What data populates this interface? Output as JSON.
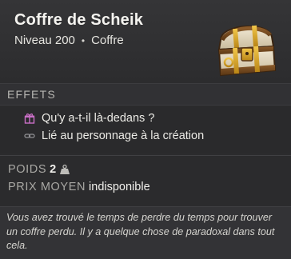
{
  "item": {
    "name": "Coffre de Scheik",
    "level_text": "Niveau 200",
    "separator": "•",
    "category": "Coffre",
    "icon": "treasure-chest-icon"
  },
  "effects": {
    "heading": "EFFETS",
    "rows": [
      {
        "icon": "gift-icon",
        "icon_color": "#c96fc6",
        "text": "Qu'y a-t-il là-dedans ?"
      },
      {
        "icon": "link-icon",
        "icon_color": "#8f8f93",
        "text": "Lié au personnage à la création"
      }
    ]
  },
  "stats": {
    "weight_label": "POIDS",
    "weight_value": "2",
    "weight_icon": "weight-icon",
    "price_label": "PRIX MOYEN",
    "price_value": "indisponible"
  },
  "lore": {
    "text": "Vous avez trouvé le temps de perdre du temps pour trouver un coffre perdu. Il y a quelque chose de paradoxal dans tout cela."
  },
  "colors": {
    "background": "#2b2b2d",
    "text": "#ecebe6",
    "muted": "#a9a8a4",
    "accent_gift": "#c96fc6"
  }
}
